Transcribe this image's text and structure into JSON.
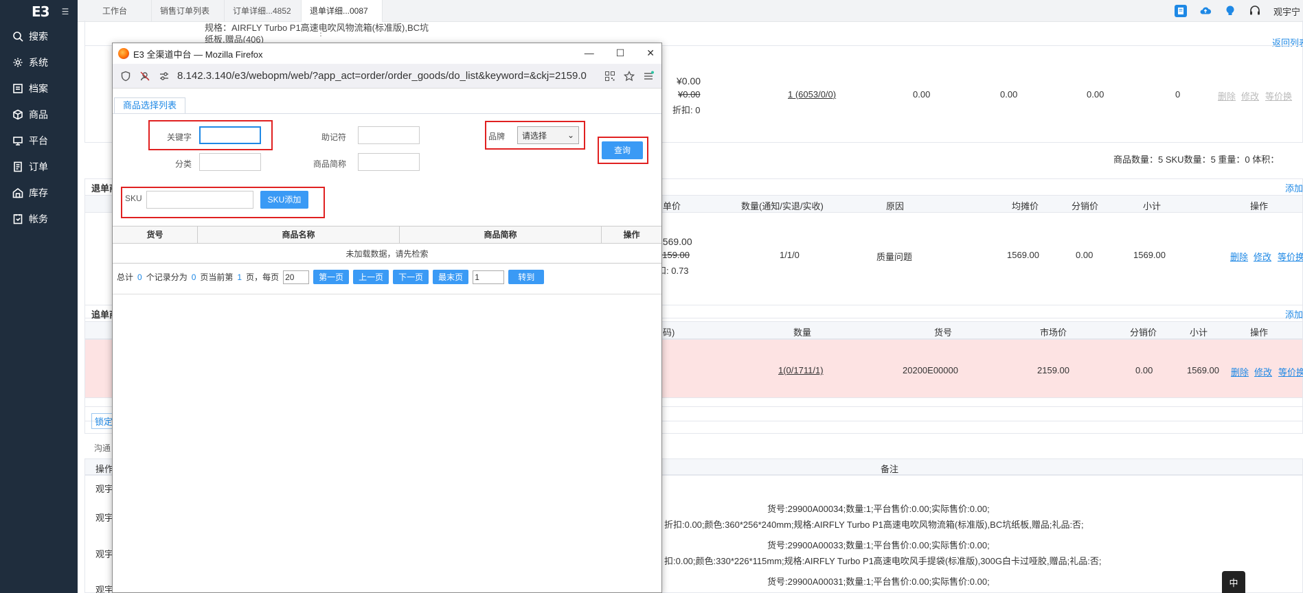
{
  "sidebar": {
    "logo": "E3",
    "collapse_icon": "menu-fold-icon",
    "items": [
      {
        "label": "搜索",
        "icon": "search-icon"
      },
      {
        "label": "系统",
        "icon": "gear-icon"
      },
      {
        "label": "档案",
        "icon": "archive-icon"
      },
      {
        "label": "商品",
        "icon": "box-icon"
      },
      {
        "label": "平台",
        "icon": "platform-icon"
      },
      {
        "label": "订单",
        "icon": "order-icon"
      },
      {
        "label": "库存",
        "icon": "warehouse-icon"
      },
      {
        "label": "帐务",
        "icon": "ledger-icon"
      }
    ]
  },
  "tabs": [
    {
      "label": "工作台"
    },
    {
      "label": "销售订单列表"
    },
    {
      "label": "订单详细...4852"
    },
    {
      "label": "退单详细...0087"
    }
  ],
  "tab_more": "⋮",
  "header": {
    "user": "观宇宁"
  },
  "background": {
    "spec_line1": "规格：AIRFLY Turbo P1高速电吹风物流箱(标准版),BC坑",
    "spec_line2": "纸板,赠品(406)",
    "return_list": "返回列表",
    "price": "¥0.00",
    "price_strike": "¥0.00",
    "discount": "折扣:  0",
    "qty_link": "1 (6053/0/0)",
    "zero1": "0.00",
    "zero2": "0.00",
    "zero3": "0.00",
    "zero4": "0",
    "action_delete": "删除",
    "action_edit": "修改",
    "action_equal": "等价换",
    "summary": "商品数量：5   SKU数量：5   重量：0   体积：",
    "section1_title": "退单商",
    "add1": "添加",
    "t1_headers": [
      "单价",
      "数量(通知/实退/实收)",
      "原因",
      "均摊价",
      "分销价",
      "小计",
      "操作"
    ],
    "t1_row": {
      "price": "1569.00",
      "price_strike": "2159.00",
      "discount": "扣:  0.73",
      "qty": "1/1/0",
      "reason": "质量问题",
      "avg": "1569.00",
      "dist": "0.00",
      "subtotal": "1569.00"
    },
    "section2_title": "追单商",
    "add2": "添加",
    "t2_headers": [
      "码)",
      "数量",
      "货号",
      "市场价",
      "分销价",
      "小计",
      "操作"
    ],
    "t2_row": {
      "qty": "1(0/1711/1)",
      "sku": "20200E00000",
      "market": "2159.00",
      "dist": "0.00",
      "subtotal": "1569.00"
    },
    "lock_btn": "锁定",
    "comm_label": "沟通",
    "op_label": "操作",
    "remark_header": "备注",
    "ops": [
      "观宇",
      "观宇",
      "观宇",
      "观宇"
    ],
    "remarks": [
      "货号:29900A00034;数量:1;平台售价:0.00;实际售价:0.00;",
      "折扣:0.00;颜色:360*256*240mm;规格:AIRFLY Turbo P1高速电吹风物流箱(标准版),BC坑纸板,赠品;礼品:否;",
      "货号:29900A00033;数量:1;平台售价:0.00;实际售价:0.00;",
      "扣:0.00;颜色:330*226*115mm;规格:AIRFLY Turbo P1高速电吹风手提袋(标准版),300G白卡过哑胶,赠品;礼品:否;",
      "货号:29900A00031;数量:1;平台售价:0.00;实际售价:0.00;"
    ],
    "ime_badge": "中"
  },
  "popup": {
    "title": "E3 全渠道中台 — Mozilla Firefox",
    "url": "8.142.3.140/e3/webopm/web/?app_act=order/order_goods/do_list&keyword=&ckj=2159.0",
    "tab_label": "商品选择列表",
    "keyword_label": "关键字",
    "keyword_value": "",
    "mnemonic_label": "助记符",
    "mnemonic_value": "",
    "brand_label": "品牌",
    "brand_selected": "请选择",
    "category_label": "分类",
    "category_value": "",
    "short_name_label": "商品简称",
    "short_name_value": "",
    "query_button": "查询",
    "sku_label": "SKU",
    "sku_value": "",
    "sku_add_button": "SKU添加",
    "grid_headers": [
      "货号",
      "商品名称",
      "商品简称",
      "操作"
    ],
    "empty_text": "未加载数据，请先检索",
    "pager": {
      "total_prefix": "总计",
      "total": "0",
      "records_split": "个记录分为",
      "pages": "0",
      "page_current_label": "页当前第",
      "current": "1",
      "page_per_label": "页，每页",
      "per_page": "20",
      "first": "第一页",
      "prev": "上一页",
      "next": "下一页",
      "last": "最末页",
      "goto_value": "1",
      "goto": "转到"
    }
  }
}
